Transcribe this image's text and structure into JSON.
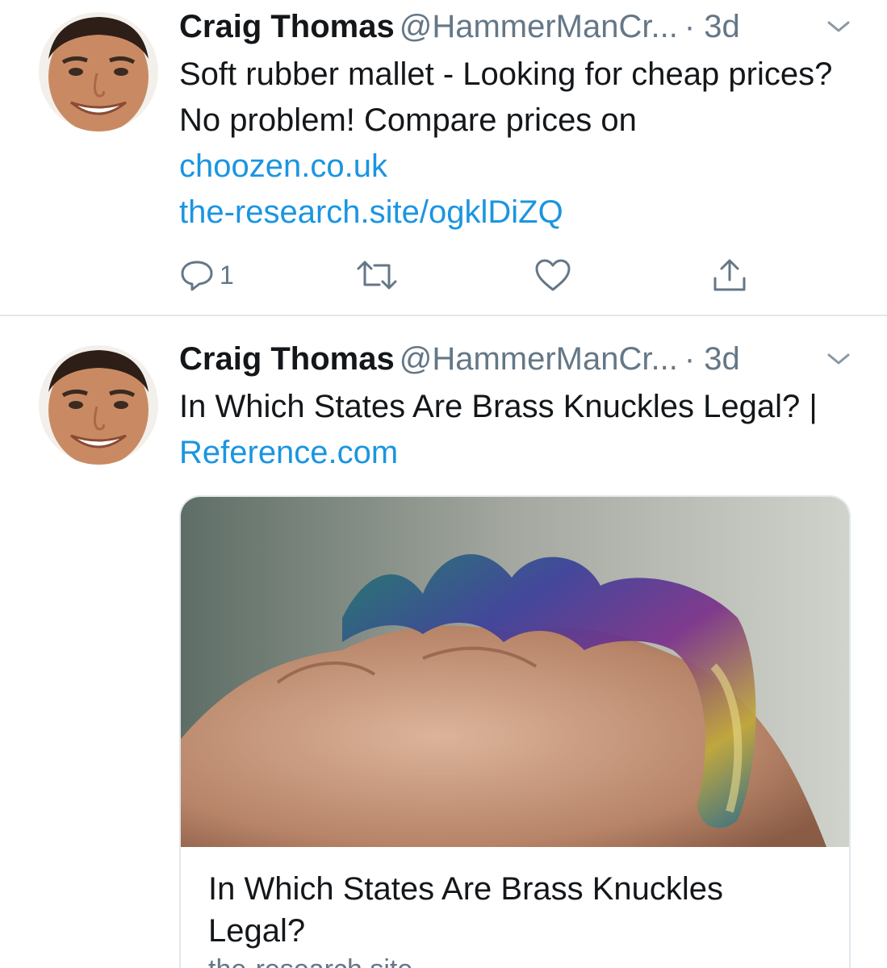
{
  "tweets": [
    {
      "author_name": "Craig Thomas",
      "author_handle": "@HammerManCr...",
      "time": "· 3d",
      "text": "Soft rubber mallet - Looking for cheap prices? No problem! Compare prices on",
      "links": [
        "choozen.co.uk",
        "the-research.site/ogklDiZQ"
      ],
      "reply_count": "1"
    },
    {
      "author_name": "Craig Thomas",
      "author_handle": "@HammerManCr...",
      "time": "· 3d",
      "text": "In Which States Are Brass Knuckles Legal? |",
      "link": "Reference.com",
      "card": {
        "title": "In Which States Are Brass Knuckles Legal?",
        "domain": "the-research.site"
      }
    }
  ],
  "icons": {
    "reply": "reply-icon",
    "retweet": "retweet-icon",
    "like": "heart-icon",
    "share": "share-icon",
    "caret": "chevron-down-icon"
  },
  "colors": {
    "link": "#1b95e0",
    "secondary_text": "#657786",
    "divider": "#e1e8ed"
  }
}
